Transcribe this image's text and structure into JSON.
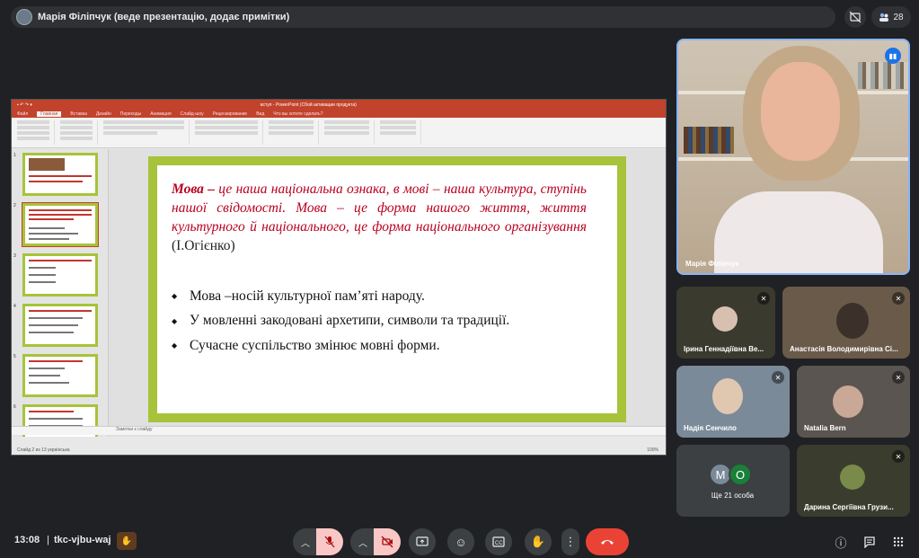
{
  "presenter_bar": {
    "title": "Марія Філіпчук (веде презентацію, додає примітки)",
    "participant_count": "28"
  },
  "slide_window": {
    "app_title": "вступ - PowerPoint (Сбой активации продукта)",
    "tabs": [
      "Файл",
      "Главная",
      "Вставка",
      "Дизайн",
      "Переходы",
      "Анимация",
      "Слайд-шоу",
      "Рецензирование",
      "Вид",
      "Что вы хотите сделать?"
    ],
    "notes_placeholder": "Заметки к слайду",
    "status_left": "Слайд 2 из 13   українська",
    "zoom": "100%",
    "slide": {
      "quote_lead": "Мова –",
      "quote_body": " це наша національна ознака, в мові – наша культура, ступінь нашої свідомості. Мова – це форма нашого життя, життя культурного й національного, це форма національного організування ",
      "quote_author": "(І.Огієнко)",
      "bullets": [
        "Мова –носій культурної пам’яті народу.",
        "У мовленні закодовані архетипи, символи та традиції.",
        "Сучасне суспільство змінює мовні форми."
      ]
    },
    "thumbnail_numbers": [
      "1",
      "2",
      "3",
      "4",
      "5",
      "6"
    ]
  },
  "participants": {
    "main": {
      "name": "Марія Філіпчук"
    },
    "tiles": [
      {
        "name": "Ірина Геннадіївна Ве..."
      },
      {
        "name": "Анастасія Володимирівна Сі..."
      },
      {
        "name": "Надія Сенчило"
      },
      {
        "name": "Natalia Bern"
      },
      {
        "name": "Дарина Сергіївна Грузи..."
      }
    ],
    "more": {
      "label": "Ще 21 особа",
      "avatars": [
        "M",
        "O"
      ]
    }
  },
  "bottom_bar": {
    "time": "13:08",
    "separator": "|",
    "meeting_code": "tkc-vjbu-waj"
  },
  "colors": {
    "background": "#202124",
    "tile": "#3c4043",
    "end_call": "#ea4335",
    "muted": "#f9c8c6",
    "slide_border": "#a7c33a",
    "quote_text": "#b8001f"
  }
}
